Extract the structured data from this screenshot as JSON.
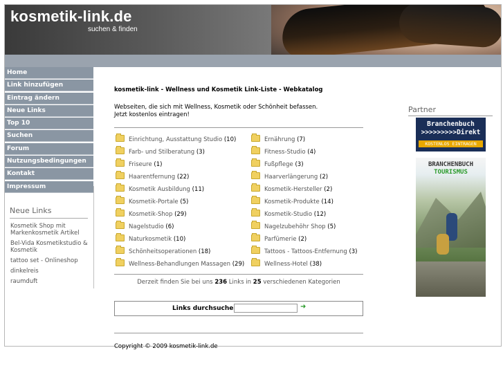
{
  "header": {
    "logo": "kosmetik-link.de",
    "slogan": "suchen & finden"
  },
  "nav": [
    "Home",
    "Link hinzufügen",
    "Eintrag ändern",
    "Neue Links",
    "Top 10",
    "Suchen",
    "Forum",
    "Nutzungsbedingungen",
    "Kontakt",
    "Impressum"
  ],
  "sidebar": {
    "title": "Neue Links",
    "items": [
      "Kosmetik Shop mit Markenkosmetik Artikel",
      "Bel-Vida Kosmetikstudio & Kosmetik",
      "tattoo set - Onlineshop",
      "dinkelreis",
      "raumduft"
    ]
  },
  "main": {
    "heading": "kosmetik-link - Wellness und Kosmetik Link-Liste - Webkatalog",
    "intro_line1": "Webseiten, die sich mit Wellness, Kosmetik oder Schönheit befassen.",
    "intro_line2": "Jetzt kostenlos eintragen!",
    "categories_left": [
      {
        "name": "Einrichtung, Ausstattung Studio",
        "count": "(10)"
      },
      {
        "name": "Farb- und Stilberatung",
        "count": "(3)"
      },
      {
        "name": "Friseure",
        "count": "(1)"
      },
      {
        "name": "Haarentfernung",
        "count": "(22)"
      },
      {
        "name": "Kosmetik Ausbildung",
        "count": "(11)"
      },
      {
        "name": "Kosmetik-Portale",
        "count": "(5)"
      },
      {
        "name": "Kosmetik-Shop",
        "count": "(29)"
      },
      {
        "name": "Nagelstudio",
        "count": "(6)"
      },
      {
        "name": "Naturkosmetik",
        "count": "(10)"
      },
      {
        "name": "Schönheitsoperationen",
        "count": "(18)"
      },
      {
        "name": "Wellness-Behandlungen Massagen",
        "count": "(29)"
      }
    ],
    "categories_right": [
      {
        "name": "Ernährung",
        "count": "(7)"
      },
      {
        "name": "Fitness-Studio",
        "count": "(4)"
      },
      {
        "name": "Fußpflege",
        "count": "(3)"
      },
      {
        "name": "Haarverlängerung",
        "count": "(2)"
      },
      {
        "name": "Kosmetik-Hersteller",
        "count": "(2)"
      },
      {
        "name": "Kosmetik-Produkte",
        "count": "(14)"
      },
      {
        "name": "Kosmetik-Studio",
        "count": "(12)"
      },
      {
        "name": "Nagelzubehöhr Shop",
        "count": "(5)"
      },
      {
        "name": "Parfümerie",
        "count": "(2)"
      },
      {
        "name": "Tattoos - Tattoos-Entfernung",
        "count": "(3)"
      },
      {
        "name": "Wellness-Hotel",
        "count": "(38)"
      }
    ],
    "summary_prefix": "Derzeit finden Sie bei uns",
    "summary_links": "236",
    "summary_middle": "Links in",
    "summary_cats": "25",
    "summary_suffix": "verschiedenen Kategorien",
    "search_label": "Links durchsuchen",
    "search_value": "",
    "copyright": "Copyright © 2009 kosmetik-link.de"
  },
  "partner": {
    "title": "Partner",
    "ad1_line1": "Branchenbuch",
    "ad1_line2": ">>>>>>>>>Direkt",
    "ad1_line3": "KOSTENLOS EINTRAGEN",
    "ad2_line1": "BRANCHENBUCH",
    "ad2_line2": "TOURISMUS"
  }
}
